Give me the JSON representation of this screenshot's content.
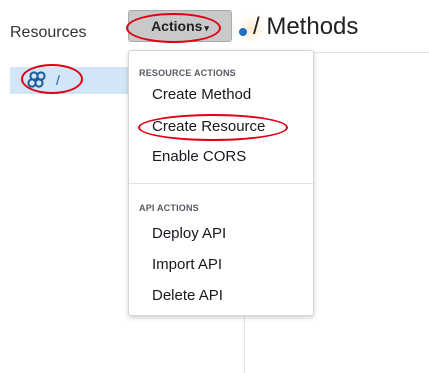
{
  "sidebar": {
    "title": "Resources",
    "resource": {
      "path": "/",
      "icon": "resource-cluster-icon"
    }
  },
  "header": {
    "actions_label": "Actions",
    "caret": "▾",
    "methods_title": "/ Methods"
  },
  "actions_menu": {
    "resource_section": "RESOURCE ACTIONS",
    "resource_items": [
      "Create Method",
      "Create Resource",
      "Enable CORS"
    ],
    "api_section": "API ACTIONS",
    "api_items": [
      "Deploy API",
      "Import API",
      "Delete API"
    ]
  },
  "colors": {
    "annotation": "#e00014",
    "selected_row": "#d3e6f7",
    "resource_link": "#1a5b9b",
    "status_dot": "#1f6fc6"
  }
}
